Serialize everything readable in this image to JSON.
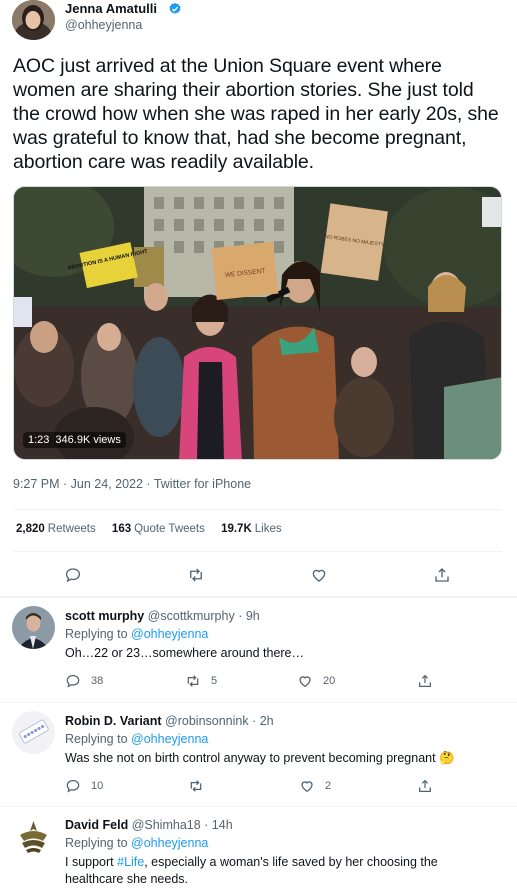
{
  "tweet": {
    "author_name": "Jenna Amatulli",
    "author_handle": "@ohheyjenna",
    "text": "AOC just arrived at the Union Square event where women are sharing their abortion stories. She just told the crowd how when she was raped in her early 20s, she was grateful to know that, had she become pregnant, abortion care was readily available.",
    "media": {
      "duration": "1:23",
      "views": "346.9K views",
      "signs": [
        "ABORTION IS A HUMAN RIGHT",
        "WE DISSENT",
        "NO ROBES NO MAJESTY"
      ]
    },
    "timestamp": "9:27 PM · Jun 24, 2022 · Twitter for iPhone",
    "stats": {
      "retweets_count": "2,820",
      "retweets_label": "Retweets",
      "quotes_count": "163",
      "quotes_label": "Quote Tweets",
      "likes_count": "19.7K",
      "likes_label": "Likes"
    },
    "actions": [
      "reply-icon",
      "retweet-icon",
      "like-icon",
      "share-icon"
    ]
  },
  "replies": [
    {
      "name": "scott murphy",
      "handle": "@scottkmurphy",
      "time": "· 9h",
      "replying_prefix": "Replying to",
      "replying_to": "@ohheyjenna",
      "text": "Oh…22 or 23…somewhere around there…",
      "reply_count": "38",
      "retweet_count": "5",
      "like_count": "20"
    },
    {
      "name": "Robin D. Variant",
      "handle": "@robinsonnink",
      "time": "· 2h",
      "replying_prefix": "Replying to",
      "replying_to": "@ohheyjenna",
      "text": "Was she not on birth control anyway to prevent becoming pregnant",
      "emoji": "🤔",
      "reply_count": "10",
      "retweet_count": "",
      "like_count": "2"
    },
    {
      "name": "David Feld",
      "handle": "@Shimha18",
      "time": "· 14h",
      "replying_prefix": "Replying to",
      "replying_to": "@ohheyjenna",
      "text_before": "I support",
      "hashtag": "#Life",
      "text_after": ", especially a woman's life saved by her choosing the healthcare she needs."
    }
  ],
  "colors": {
    "accent": "#1d9bf0",
    "text": "#0f1419",
    "secondary": "#536471",
    "divider": "#eff3f4"
  }
}
